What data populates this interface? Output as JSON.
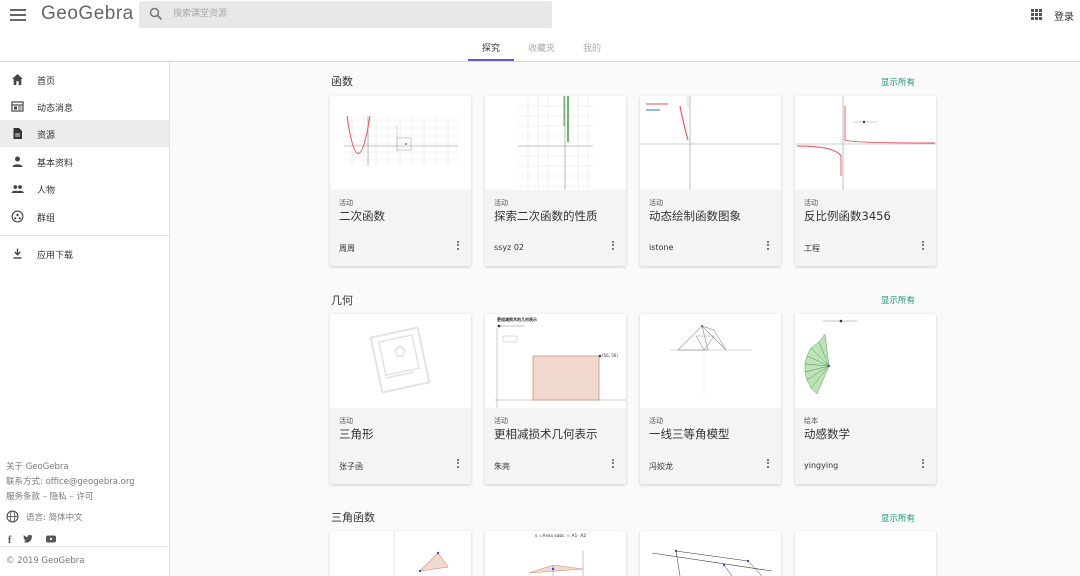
{
  "header": {
    "logo": "GeoGebra",
    "search_placeholder": "搜索课堂资源",
    "login_label": "登录"
  },
  "tabs": [
    {
      "label": "探究",
      "active": true
    },
    {
      "label": "收藏夹",
      "active": false
    },
    {
      "label": "我的",
      "active": false
    }
  ],
  "sidebar": {
    "items": [
      {
        "label": "首页",
        "icon": "home-icon"
      },
      {
        "label": "动态消息",
        "icon": "news-feed-icon"
      },
      {
        "label": "资源",
        "icon": "document-icon",
        "active": true
      },
      {
        "label": "基本资料",
        "icon": "person-icon"
      },
      {
        "label": "人物",
        "icon": "people-icon"
      },
      {
        "label": "群组",
        "icon": "group-icon"
      }
    ],
    "download_label": "应用下载",
    "footer": {
      "about": "关于 GeoGebra",
      "contact": "联系方式: office@geogebra.org",
      "terms": "服务条款",
      "privacy": "隐私",
      "license": "许可",
      "language": "语言: 简体中文",
      "copyright": "© 2019 GeoGebra"
    }
  },
  "sections": [
    {
      "title": "函数",
      "show_all": "显示所有",
      "cards": [
        {
          "type": "活动",
          "title": "二次函数",
          "author": "周周"
        },
        {
          "type": "活动",
          "title": "探索二次函数的性质",
          "author": "ssyz 02"
        },
        {
          "type": "活动",
          "title": "动态绘制函数图象",
          "author": "istone"
        },
        {
          "type": "活动",
          "title": "反比例函数3456",
          "author": "工程"
        }
      ]
    },
    {
      "title": "几何",
      "show_all": "显示所有",
      "cards": [
        {
          "type": "活动",
          "title": "三角形",
          "author": "张子函"
        },
        {
          "type": "活动",
          "title": "更相减损术几何表示",
          "author": "朱亮",
          "thumb_heading": "更相减损术的几何表示",
          "thumb_point": "(56, 56)"
        },
        {
          "type": "活动",
          "title": "一线三等角模型",
          "author": "冯姣龙"
        },
        {
          "type": "绘本",
          "title": "动感数学",
          "author": "yingying"
        }
      ]
    },
    {
      "title": "三角函数",
      "show_all": "显示所有",
      "cards": [
        {
          "thumb_label": "s =Area sabc = A1· A2"
        }
      ]
    }
  ],
  "colors": {
    "accent": "#6557d2",
    "link": "#1a8f74",
    "curve": "#e0505a"
  }
}
